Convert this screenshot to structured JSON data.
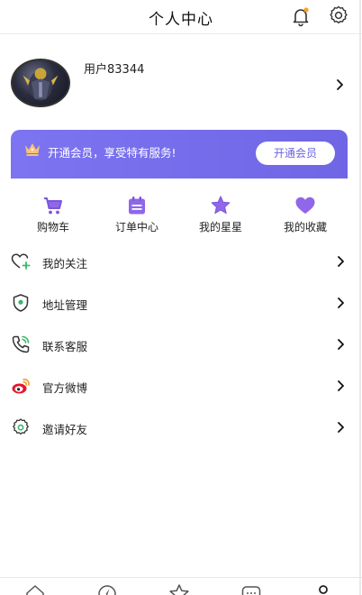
{
  "header": {
    "title": "个人中心",
    "bell_icon": "bell-icon",
    "settings_icon": "gear-icon",
    "notification_dot_color": "#f5a623"
  },
  "profile": {
    "username": "用户83344",
    "avatar_icon": "avatar-image"
  },
  "vip": {
    "text": "开通会员，享受特有服务!",
    "button": "开通会员",
    "crown_icon": "crown-icon",
    "accent": "#7469ec"
  },
  "quick": [
    {
      "label": "购物车",
      "icon": "cart-icon"
    },
    {
      "label": "订单中心",
      "icon": "calendar-icon"
    },
    {
      "label": "我的星星",
      "icon": "star-icon"
    },
    {
      "label": "我的收藏",
      "icon": "heart-icon"
    }
  ],
  "menu": [
    {
      "label": "我的关注",
      "icon": "heart-plus-icon"
    },
    {
      "label": "地址管理",
      "icon": "location-shield-icon"
    },
    {
      "label": "联系客服",
      "icon": "phone-icon"
    },
    {
      "label": "官方微博",
      "icon": "weibo-icon"
    },
    {
      "label": "邀请好友",
      "icon": "share-gear-icon"
    }
  ],
  "tabbar": [
    "home-icon",
    "discover-icon",
    "star-icon",
    "message-icon",
    "profile-icon"
  ]
}
